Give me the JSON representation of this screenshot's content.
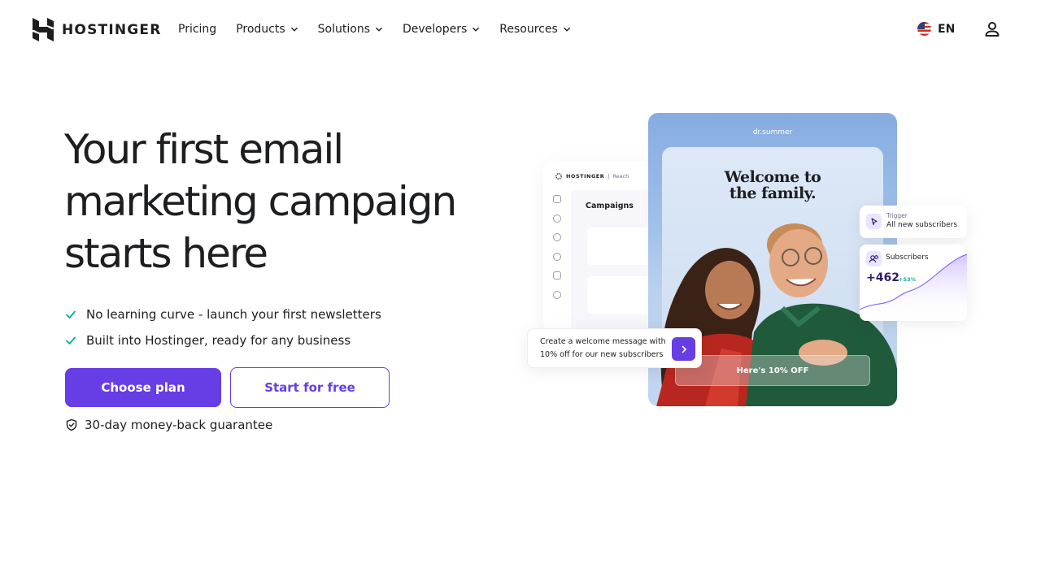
{
  "brand": {
    "name": "HOSTINGER",
    "accent": "#673de6",
    "text": "#1d1e20"
  },
  "nav": {
    "items": [
      {
        "label": "Pricing",
        "dropdown": false
      },
      {
        "label": "Products",
        "dropdown": true
      },
      {
        "label": "Solutions",
        "dropdown": true
      },
      {
        "label": "Developers",
        "dropdown": true
      },
      {
        "label": "Resources",
        "dropdown": true
      }
    ],
    "language": {
      "code": "EN",
      "flag_icon": "us-flag-icon"
    },
    "account_icon": "user-icon"
  },
  "hero": {
    "title_lines": [
      "Your first email",
      "marketing campaign",
      "starts here"
    ],
    "bullets": [
      "No learning curve - launch your first newsletters",
      "Built into Hostinger, ready for any business"
    ],
    "primary_cta": "Choose plan",
    "secondary_cta": "Start for free",
    "guarantee": "30-day money-back guarantee"
  },
  "illustration": {
    "app": {
      "brand": "HOSTINGER",
      "product": "Reach",
      "section": "Campaigns"
    },
    "email": {
      "brand": "dr.summer",
      "headline_lines": [
        "Welcome to",
        "the family."
      ],
      "offer_button": "Here's 10% OFF"
    },
    "trigger": {
      "label": "Trigger",
      "value": "All new subscribers"
    },
    "subscribers": {
      "label": "Subscribers",
      "count": "+462",
      "delta": "+53%",
      "delta_color": "#00b090"
    },
    "prompt": {
      "text": "Create a welcome message with 10% off for our new subscribers"
    }
  }
}
